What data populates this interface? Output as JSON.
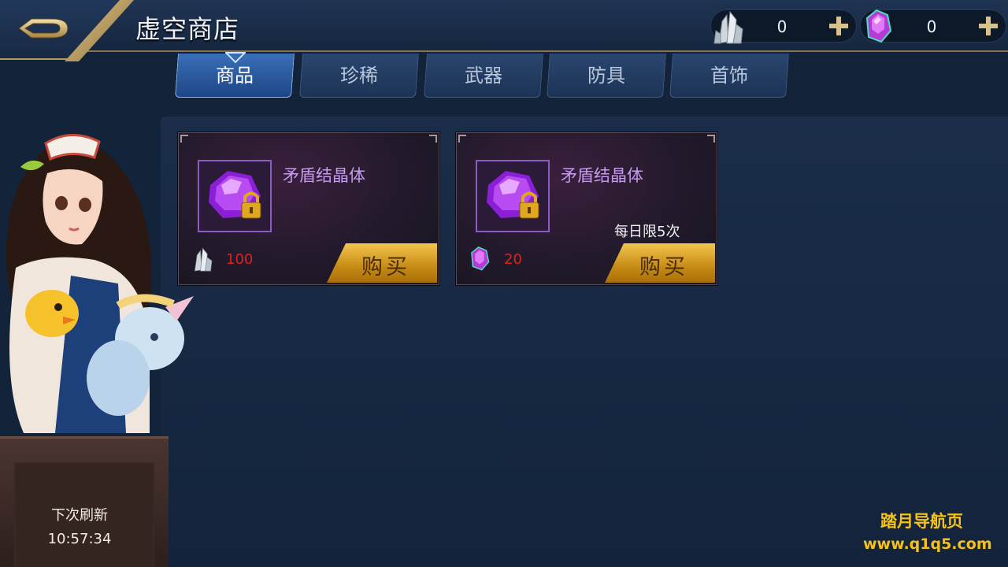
{
  "header": {
    "title": "虚空商店",
    "currencies": [
      {
        "name": "crystal",
        "icon": "crystal-cluster-icon",
        "value": "0"
      },
      {
        "name": "gem",
        "icon": "purple-gem-icon",
        "value": "0"
      }
    ]
  },
  "tabs": [
    {
      "label": "商品",
      "active": true
    },
    {
      "label": "珍稀",
      "active": false
    },
    {
      "label": "武器",
      "active": false
    },
    {
      "label": "防具",
      "active": false
    },
    {
      "label": "首饰",
      "active": false
    }
  ],
  "items": [
    {
      "name": "矛盾结晶体",
      "limit": "",
      "price": "100",
      "price_icon": "crystal-cluster-icon",
      "buy_label": "购买",
      "locked": true
    },
    {
      "name": "矛盾结晶体",
      "limit": "每日限5次",
      "price": "20",
      "price_icon": "purple-gem-icon",
      "buy_label": "购买",
      "locked": true
    }
  ],
  "refresh": {
    "label": "下次刷新",
    "time": "10:57:34"
  },
  "watermark": {
    "title": "踏月导航页",
    "url": "www.q1q5.com"
  },
  "colors": {
    "accent_gold": "#c68b14",
    "item_name": "#c79cf0",
    "price_red": "#e0201c",
    "watermark": "#f4c21b"
  }
}
